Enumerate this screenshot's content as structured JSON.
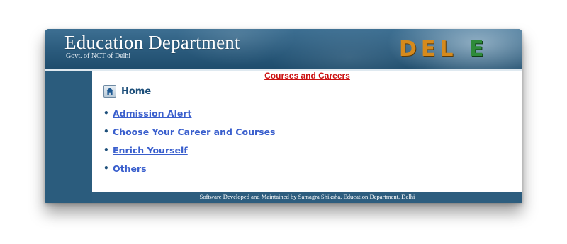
{
  "header": {
    "title": "Education Department",
    "subtitle": "Govt. of NCT of Delhi",
    "logo_part1": "DEL",
    "logo_part2": "E"
  },
  "main": {
    "section_title": "Courses and Careers",
    "home_label": "Home",
    "nav_items": [
      {
        "label": "Admission Alert"
      },
      {
        "label": "Choose Your Career and Courses"
      },
      {
        "label": "Enrich Yourself"
      },
      {
        "label": "Others"
      }
    ]
  },
  "footer": {
    "text": "Software Developed and Maintained by Samagra Shiksha, Education Department, Delhi"
  },
  "colors": {
    "banner": "#2b5c7d",
    "section_title": "#cc1111",
    "link": "#3a5fcd",
    "logo_orange": "#d68a1c",
    "logo_green": "#2e8b3a"
  },
  "icons": {
    "home": "home-icon"
  }
}
